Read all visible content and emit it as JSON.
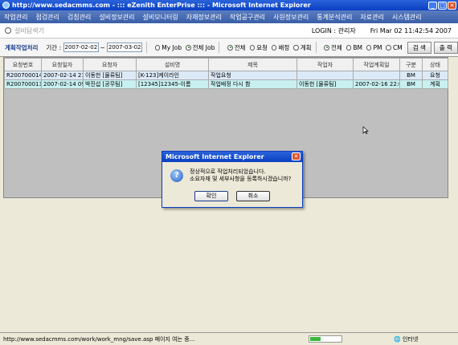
{
  "window": {
    "title": "http://www.sedacmms.com - ::: eZenith EnterPrise ::: - Microsoft Internet Explorer"
  },
  "menu": [
    "작업관리",
    "점검관리",
    "검침관리",
    "설비정보관리",
    "설비모니터링",
    "자재정보관리",
    "작업공구관리",
    "사원정보관리",
    "통계분석관리",
    "자료관리",
    "시스템관리"
  ],
  "search": {
    "placeholder": "설비탐색기"
  },
  "header": {
    "login": "LOGIN : 관리자",
    "datetime": "Fri Mar 02 11:42:54 2007"
  },
  "filter": {
    "tab_title": "계획작업처리",
    "period_label": "기간 :",
    "date_from": "2007-02-02",
    "tilde": "~",
    "date_to": "2007-03-02",
    "job_options": [
      "My Job",
      "전체 Job"
    ],
    "job_selected": "전체 Job",
    "status_options": [
      "전체",
      "요청",
      "배정",
      "계획"
    ],
    "status_selected": "전체",
    "type_options": [
      "전체",
      "BM",
      "PM",
      "CM"
    ],
    "type_selected": "전체",
    "search_button": "검 색",
    "print_button": "출 력"
  },
  "table": {
    "columns": [
      "요청번호",
      "요청일자",
      "요청자",
      "설비명",
      "제목",
      "작업자",
      "작업계획일",
      "구분",
      "상태"
    ],
    "rows": [
      [
        "R200700014",
        "2007-02-14 21:29",
        "이동헌 [물류팀]",
        "[K-123]케이라인",
        "작업요청",
        "",
        "",
        "BM",
        "요청"
      ],
      [
        "R200700013",
        "2007-02-14 09:52",
        "박진섭 [공무팀]",
        "[12345]12345-이름",
        "작업배정 다시 함",
        "이동헌 [물류팀]",
        "2007-02-16 22:00",
        "BM",
        "계획"
      ]
    ]
  },
  "dialog": {
    "title": "Microsoft Internet Explorer",
    "line1": "정상적으로 작업처리되었습니다.",
    "line2": "소요자재 및 세부사항을 등록하시겠습니까?",
    "ok": "확인",
    "cancel": "취소"
  },
  "status": {
    "url": "http://www.sedacmms.com/work/work_mng/save.asp 페이지 여는 중...",
    "zone": "인터넷",
    "progress": 0.35
  }
}
